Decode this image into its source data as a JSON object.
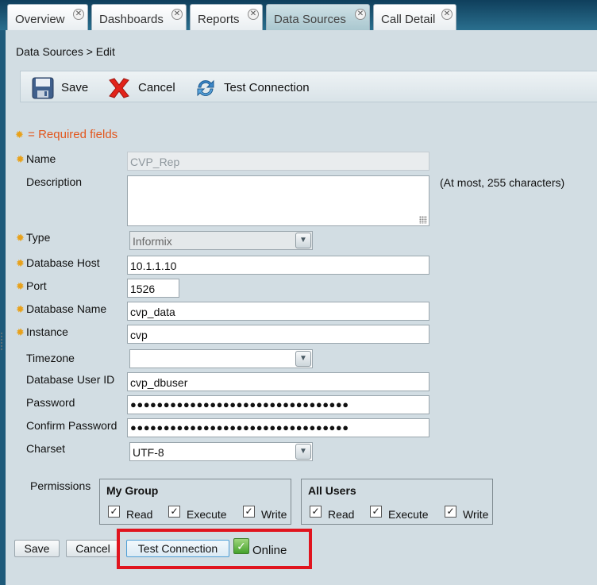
{
  "tabs": [
    {
      "label": "Overview",
      "active": false
    },
    {
      "label": "Dashboards",
      "active": false
    },
    {
      "label": "Reports",
      "active": false
    },
    {
      "label": "Data Sources",
      "active": true
    },
    {
      "label": "Call Detail",
      "active": false
    }
  ],
  "breadcrumb": "Data Sources >  Edit",
  "toolbar": {
    "save": "Save",
    "cancel": "Cancel",
    "test": "Test Connection"
  },
  "required_note": "= Required fields",
  "form": {
    "name_label": "Name",
    "name_value": "CVP_Rep",
    "description_label": "Description",
    "description_value": "",
    "description_hint": "(At most, 255 characters)",
    "type_label": "Type",
    "type_value": "Informix",
    "host_label": "Database Host",
    "host_value": "10.1.1.10",
    "port_label": "Port",
    "port_value": "1526",
    "dbname_label": "Database Name",
    "dbname_value": "cvp_data",
    "instance_label": "Instance",
    "instance_value": "cvp",
    "timezone_label": "Timezone",
    "timezone_value": "",
    "userid_label": "Database User ID",
    "userid_value": "cvp_dbuser",
    "password_label": "Password",
    "password_value": "●●●●●●●●●●●●●●●●●●●●●●●●●●●●●●●●●",
    "confirm_label": "Confirm Password",
    "confirm_value": "●●●●●●●●●●●●●●●●●●●●●●●●●●●●●●●●●",
    "charset_label": "Charset",
    "charset_value": "UTF-8"
  },
  "permissions": {
    "label": "Permissions",
    "my_group": {
      "title": "My Group",
      "read": "Read",
      "execute": "Execute",
      "write": "Write"
    },
    "all_users": {
      "title": "All Users",
      "read": "Read",
      "execute": "Execute",
      "write": "Write"
    }
  },
  "bottom": {
    "save": "Save",
    "cancel": "Cancel",
    "test": "Test Connection",
    "status": "Online"
  },
  "colors": {
    "required": "#e2571e",
    "highlight": "#e0141e",
    "status_ok": "#46a22c"
  },
  "icons": [
    "close-icon",
    "save-icon",
    "cancel-icon",
    "refresh-icon",
    "gear-icon",
    "checkbox-icon",
    "check-icon",
    "chevron-down-icon"
  ]
}
